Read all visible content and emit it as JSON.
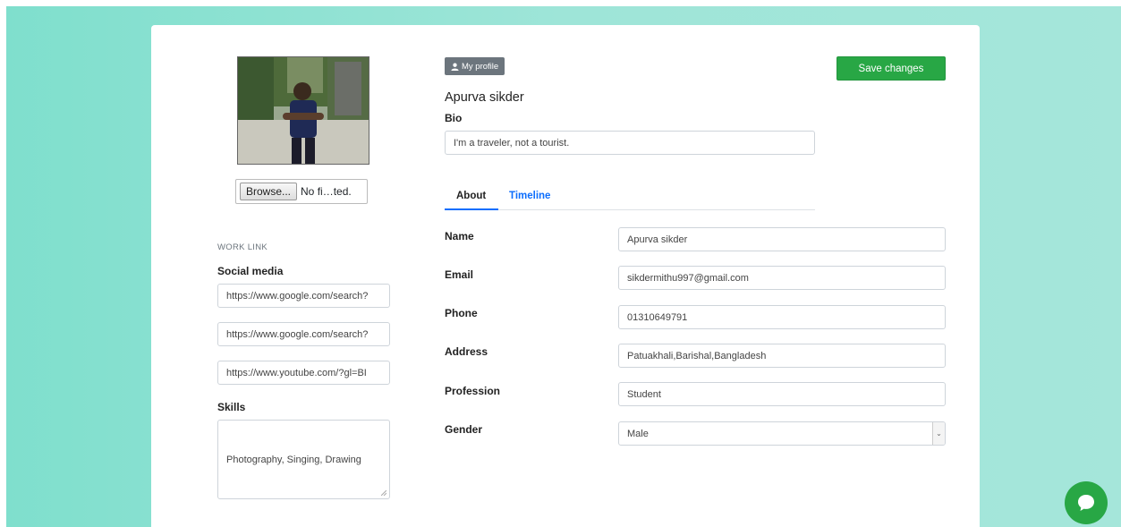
{
  "profile": {
    "badge_label": "My profile",
    "badge_icon": "user-icon",
    "display_name": "Apurva sikder",
    "save_label": "Save changes",
    "file_browse_label": "Browse...",
    "file_status": "No fi…ted."
  },
  "bio": {
    "label": "Bio",
    "value": "I'm a traveler, not a tourist."
  },
  "tabs": [
    {
      "label": "About",
      "active": true
    },
    {
      "label": "Timeline",
      "active": false
    }
  ],
  "work": {
    "section_label": "WORK LINK",
    "social_label": "Social media",
    "links": [
      "https://www.google.com/search?",
      "https://www.google.com/search?",
      "https://www.youtube.com/?gl=BI"
    ],
    "skills_label": "Skills",
    "skills_value": "Photography, Singing, Drawing"
  },
  "fields": {
    "name": {
      "label": "Name",
      "value": "Apurva sikder"
    },
    "email": {
      "label": "Email",
      "value": "sikdermithu997@gmail.com"
    },
    "phone": {
      "label": "Phone",
      "value": "01310649791"
    },
    "address": {
      "label": "Address",
      "value": "Patuakhali,Barishal,Bangladesh"
    },
    "profession": {
      "label": "Profession",
      "value": "Student"
    },
    "gender": {
      "label": "Gender",
      "value": "Male"
    }
  },
  "colors": {
    "accent_green": "#28a745",
    "link_blue": "#0d6efd",
    "background_teal": "#9ee5d8"
  },
  "icons": {
    "chat": "chat-bubble-icon",
    "select": "chevron-down-icon"
  }
}
